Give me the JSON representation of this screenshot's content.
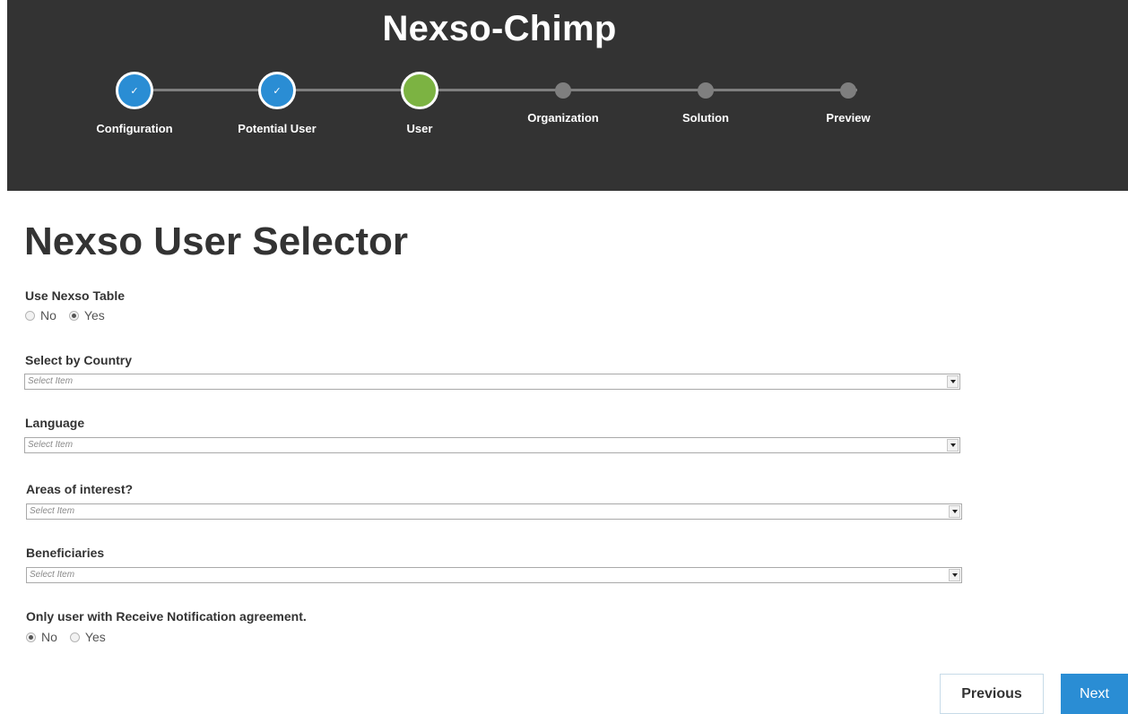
{
  "header": {
    "title": "Nexso-Chimp",
    "steps": [
      {
        "label": "Configuration",
        "status": "complete",
        "icon": "check-icon"
      },
      {
        "label": "Potential User",
        "status": "complete",
        "icon": "check-icon"
      },
      {
        "label": "User",
        "status": "current"
      },
      {
        "label": "Organization",
        "status": "pending"
      },
      {
        "label": "Solution",
        "status": "pending"
      },
      {
        "label": "Preview",
        "status": "pending"
      }
    ],
    "colors": {
      "complete": "#2a8dd4",
      "current": "#7cb342",
      "pending": "#7f7f7f",
      "background": "#333333"
    }
  },
  "page_title": "Nexso User Selector",
  "form": {
    "use_nexso_table": {
      "label": "Use Nexso Table",
      "options": [
        "No",
        "Yes"
      ],
      "selected": "Yes"
    },
    "country": {
      "label": "Select by Country",
      "placeholder": "Select Item"
    },
    "language": {
      "label": "Language",
      "placeholder": "Select Item"
    },
    "areas": {
      "label": "Areas of interest?",
      "placeholder": "Select Item"
    },
    "beneficiaries": {
      "label": "Beneficiaries",
      "placeholder": "Select Item"
    },
    "notification": {
      "label": "Only user with Receive Notification agreement.",
      "options": [
        "No",
        "Yes"
      ],
      "selected": "No"
    }
  },
  "buttons": {
    "previous": "Previous",
    "next": "Next"
  }
}
